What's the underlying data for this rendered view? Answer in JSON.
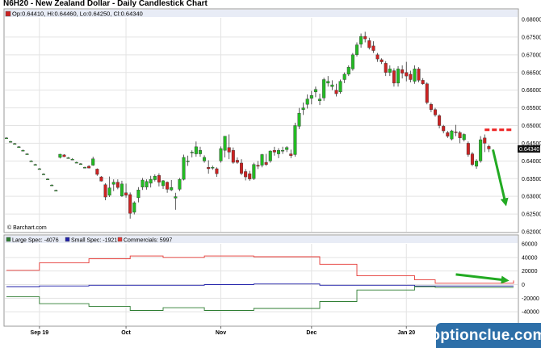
{
  "header": {
    "title": "N6H20 - New Zealand Dollar - Daily Candlestick Chart"
  },
  "watermark": {
    "text": "optionclue.com"
  },
  "colors": {
    "up": "#22bb22",
    "down": "#cc2222",
    "large_spec": "#2e7d32",
    "small_spec": "#2222aa",
    "commercials": "#e53935",
    "annotation": "#22aa22",
    "dash": "#ee2222"
  },
  "chart_data": [
    {
      "type": "candlestick",
      "title": "N6H20 - New Zealand Dollar - Daily Candlestick Chart",
      "info_line": "Op:0.64410, Hi:0.64460, Lo:0.64250, Cl:0.64340",
      "source_label": "© Barchart.com",
      "last_price_label": "0.64340",
      "ylim": [
        0.62,
        0.68
      ],
      "y_ticks": [
        "0.68000",
        "0.67500",
        "0.67000",
        "0.66500",
        "0.66000",
        "0.65500",
        "0.65000",
        "0.64500",
        "0.64000",
        "0.63500",
        "0.63000",
        "0.62500",
        "0.62000"
      ],
      "x_ticks": [
        "Sep 19",
        "Oct",
        "Nov",
        "Dec",
        "Jan 20"
      ],
      "x_tick_positions": [
        8,
        29,
        52,
        74,
        97
      ],
      "x_count": 124,
      "candles": [
        [
          0,
          0.6465,
          0.6467,
          0.6463,
          0.6465
        ],
        [
          1,
          0.6455,
          0.6457,
          0.6452,
          0.6455
        ],
        [
          2,
          0.6449,
          0.6451,
          0.6447,
          0.6449
        ],
        [
          3,
          0.644,
          0.6442,
          0.6438,
          0.644
        ],
        [
          4,
          0.643,
          0.6432,
          0.6428,
          0.643
        ],
        [
          5,
          0.642,
          0.6422,
          0.6418,
          0.642
        ],
        [
          6,
          0.64,
          0.6402,
          0.6398,
          0.64
        ],
        [
          7,
          0.639,
          0.6392,
          0.6388,
          0.639
        ],
        [
          8,
          0.6378,
          0.638,
          0.6376,
          0.6378
        ],
        [
          9,
          0.6363,
          0.6365,
          0.6361,
          0.6363
        ],
        [
          10,
          0.6349,
          0.6351,
          0.6347,
          0.6349
        ],
        [
          11,
          0.6332,
          0.6334,
          0.633,
          0.6332
        ],
        [
          12,
          0.6317,
          0.6319,
          0.6315,
          0.6317
        ],
        [
          13,
          0.641,
          0.642,
          0.6407,
          0.6419
        ],
        [
          14,
          0.6417,
          0.6419,
          0.6411,
          0.6412
        ],
        [
          15,
          0.6409,
          0.6411,
          0.6407,
          0.6409
        ],
        [
          16,
          0.6405,
          0.6408,
          0.6403,
          0.6405
        ],
        [
          17,
          0.6396,
          0.6398,
          0.6394,
          0.6396
        ],
        [
          18,
          0.6392,
          0.6394,
          0.639,
          0.6392
        ],
        [
          19,
          0.6382,
          0.6384,
          0.638,
          0.6382
        ],
        [
          20,
          0.6385,
          0.6388,
          0.6379,
          0.638
        ],
        [
          21,
          0.6388,
          0.6412,
          0.6386,
          0.6406
        ],
        [
          22,
          0.6377,
          0.6379,
          0.6358,
          0.6362
        ],
        [
          23,
          0.6355,
          0.6357,
          0.6342,
          0.6343
        ],
        [
          24,
          0.6333,
          0.6337,
          0.6289,
          0.6298
        ],
        [
          25,
          0.6303,
          0.6356,
          0.6298,
          0.6324
        ],
        [
          26,
          0.6334,
          0.6348,
          0.6315,
          0.634
        ],
        [
          27,
          0.634,
          0.6348,
          0.632,
          0.6325
        ],
        [
          28,
          0.6301,
          0.6344,
          0.6298,
          0.6335
        ],
        [
          29,
          0.631,
          0.6336,
          0.6296,
          0.6303
        ],
        [
          30,
          0.6305,
          0.6311,
          0.6237,
          0.6252
        ],
        [
          31,
          0.6255,
          0.6286,
          0.6249,
          0.6282
        ],
        [
          32,
          0.6296,
          0.6326,
          0.6283,
          0.6318
        ],
        [
          33,
          0.6326,
          0.6352,
          0.6318,
          0.6346
        ],
        [
          34,
          0.6326,
          0.6348,
          0.6319,
          0.6342
        ],
        [
          35,
          0.6337,
          0.6358,
          0.6325,
          0.6348
        ],
        [
          36,
          0.6347,
          0.6362,
          0.6342,
          0.6357
        ],
        [
          37,
          0.6359,
          0.6365,
          0.6328,
          0.634
        ],
        [
          38,
          0.633,
          0.6346,
          0.6321,
          0.6344
        ],
        [
          39,
          0.634,
          0.6342,
          0.631,
          0.632
        ],
        [
          40,
          0.6318,
          0.6346,
          0.6315,
          0.6325
        ],
        [
          41,
          0.6295,
          0.631,
          0.6262,
          0.6299
        ],
        [
          42,
          0.632,
          0.6352,
          0.6315,
          0.6348
        ],
        [
          43,
          0.6348,
          0.6418,
          0.6345,
          0.641
        ],
        [
          44,
          0.6398,
          0.6415,
          0.6386,
          0.64
        ],
        [
          45,
          0.6425,
          0.643,
          0.641,
          0.6425
        ],
        [
          46,
          0.642,
          0.6455,
          0.6412,
          0.644
        ],
        [
          47,
          0.642,
          0.644,
          0.6412,
          0.643
        ],
        [
          48,
          0.64,
          0.6416,
          0.6395,
          0.641
        ],
        [
          49,
          0.6382,
          0.6402,
          0.6364,
          0.6378
        ],
        [
          50,
          0.638,
          0.6387,
          0.6375,
          0.6382
        ],
        [
          51,
          0.6378,
          0.6382,
          0.6355,
          0.6364
        ],
        [
          52,
          0.64,
          0.6441,
          0.6395,
          0.6435
        ],
        [
          53,
          0.643,
          0.647,
          0.641,
          0.647
        ],
        [
          54,
          0.6438,
          0.6475,
          0.6405,
          0.6425
        ],
        [
          55,
          0.643,
          0.6438,
          0.6392,
          0.6396
        ],
        [
          56,
          0.6402,
          0.641,
          0.6392,
          0.6396
        ],
        [
          57,
          0.6394,
          0.6405,
          0.636,
          0.6365
        ],
        [
          58,
          0.637,
          0.6377,
          0.6345,
          0.6355
        ],
        [
          59,
          0.6364,
          0.6372,
          0.6344,
          0.6349
        ],
        [
          60,
          0.635,
          0.6395,
          0.6346,
          0.639
        ],
        [
          61,
          0.6388,
          0.64,
          0.6377,
          0.6385
        ],
        [
          62,
          0.6388,
          0.642,
          0.6382,
          0.6418
        ],
        [
          63,
          0.6396,
          0.642,
          0.6386,
          0.639
        ],
        [
          64,
          0.64,
          0.643,
          0.6395,
          0.6428
        ],
        [
          65,
          0.643,
          0.644,
          0.6415,
          0.6425
        ],
        [
          66,
          0.642,
          0.6436,
          0.6408,
          0.643
        ],
        [
          67,
          0.643,
          0.644,
          0.642,
          0.643
        ],
        [
          68,
          0.6432,
          0.6442,
          0.6425,
          0.6438
        ],
        [
          69,
          0.642,
          0.6432,
          0.6408,
          0.6415
        ],
        [
          70,
          0.6418,
          0.6508,
          0.6412,
          0.65
        ],
        [
          71,
          0.6498,
          0.655,
          0.649,
          0.6535
        ],
        [
          72,
          0.6545,
          0.6565,
          0.653,
          0.655
        ],
        [
          73,
          0.656,
          0.6588,
          0.6548,
          0.6575
        ],
        [
          74,
          0.6577,
          0.6598,
          0.656,
          0.6585
        ],
        [
          75,
          0.6595,
          0.661,
          0.658,
          0.6602
        ],
        [
          76,
          0.657,
          0.659,
          0.6558,
          0.6575
        ],
        [
          77,
          0.6578,
          0.6635,
          0.657,
          0.663
        ],
        [
          78,
          0.662,
          0.664,
          0.661,
          0.6625
        ],
        [
          79,
          0.661,
          0.6628,
          0.66,
          0.6615
        ],
        [
          80,
          0.66,
          0.6618,
          0.6582,
          0.659
        ],
        [
          81,
          0.6595,
          0.663,
          0.659,
          0.6625
        ],
        [
          82,
          0.663,
          0.665,
          0.662,
          0.6645
        ],
        [
          83,
          0.6645,
          0.667,
          0.664,
          0.6665
        ],
        [
          84,
          0.666,
          0.6705,
          0.6655,
          0.67
        ],
        [
          85,
          0.67,
          0.6735,
          0.6695,
          0.6728
        ],
        [
          86,
          0.673,
          0.676,
          0.672,
          0.6752
        ],
        [
          87,
          0.6752,
          0.6765,
          0.6735,
          0.6745
        ],
        [
          88,
          0.674,
          0.6748,
          0.6715,
          0.672
        ],
        [
          89,
          0.6725,
          0.6738,
          0.6705,
          0.6712
        ],
        [
          90,
          0.67,
          0.6705,
          0.668,
          0.6688
        ],
        [
          91,
          0.6686,
          0.669,
          0.6674,
          0.668
        ],
        [
          92,
          0.6676,
          0.6682,
          0.664,
          0.665
        ],
        [
          93,
          0.665,
          0.667,
          0.664,
          0.666
        ],
        [
          94,
          0.6655,
          0.6662,
          0.661,
          0.662
        ],
        [
          95,
          0.662,
          0.6668,
          0.661,
          0.666
        ],
        [
          96,
          0.6658,
          0.667,
          0.6633,
          0.6648
        ],
        [
          97,
          0.665,
          0.668,
          0.6625,
          0.664
        ],
        [
          98,
          0.6645,
          0.6655,
          0.6622,
          0.663
        ],
        [
          99,
          0.6625,
          0.667,
          0.6618,
          0.666
        ],
        [
          100,
          0.666,
          0.6665,
          0.6622,
          0.6628
        ],
        [
          101,
          0.6628,
          0.6634,
          0.6615,
          0.6618
        ],
        [
          102,
          0.6618,
          0.6622,
          0.656,
          0.6565
        ],
        [
          103,
          0.656,
          0.6565,
          0.6538,
          0.6545
        ],
        [
          104,
          0.6545,
          0.655,
          0.6525,
          0.653
        ],
        [
          105,
          0.6528,
          0.6532,
          0.6492,
          0.65
        ],
        [
          106,
          0.6498,
          0.6502,
          0.6478,
          0.6485
        ],
        [
          107,
          0.648,
          0.6485,
          0.6465,
          0.647
        ],
        [
          108,
          0.6462,
          0.6488,
          0.6458,
          0.6485
        ],
        [
          109,
          0.6482,
          0.6502,
          0.647,
          0.648
        ],
        [
          110,
          0.648,
          0.6485,
          0.645,
          0.6465
        ],
        [
          111,
          0.646,
          0.6478,
          0.6455,
          0.6475
        ],
        [
          112,
          0.645,
          0.6455,
          0.6412,
          0.6418
        ],
        [
          113,
          0.642,
          0.6425,
          0.6385,
          0.639
        ],
        [
          114,
          0.6385,
          0.6405,
          0.6378,
          0.64
        ],
        [
          115,
          0.64,
          0.647,
          0.6395,
          0.646
        ],
        [
          116,
          0.6465,
          0.6475,
          0.6425,
          0.645
        ],
        [
          117,
          0.6441,
          0.6446,
          0.6425,
          0.6434
        ]
      ],
      "dashed_level": {
        "value": 0.6488,
        "from_x": 116,
        "to_x": 123
      }
    },
    {
      "type": "line",
      "title": "",
      "legend": [
        {
          "label": "Large Spec: -4076"
        },
        {
          "label": "Small Spec: -1921"
        },
        {
          "label": "Commercials: 5997"
        }
      ],
      "ylim": [
        -60000,
        60000
      ],
      "y_ticks": [
        "60000",
        "40000",
        "20000",
        "0",
        "-20000",
        "-40000"
      ],
      "y_tick_values": [
        60000,
        40000,
        20000,
        0,
        -20000,
        -40000
      ],
      "series": [
        {
          "name": "Commercials",
          "points": [
            [
              0,
              21000
            ],
            [
              8,
              21000
            ],
            [
              8,
              32000
            ],
            [
              20,
              32000
            ],
            [
              20,
              38000
            ],
            [
              30,
              38000
            ],
            [
              30,
              42000
            ],
            [
              38,
              42000
            ],
            [
              38,
              40000
            ],
            [
              48,
              40000
            ],
            [
              48,
              42000
            ],
            [
              60,
              42000
            ],
            [
              60,
              41000
            ],
            [
              76,
              41000
            ],
            [
              76,
              30000
            ],
            [
              85,
              30000
            ],
            [
              85,
              13000
            ],
            [
              99,
              13000
            ],
            [
              99,
              7000
            ],
            [
              104,
              7000
            ],
            [
              104,
              2000
            ],
            [
              123,
              2000
            ],
            [
              123,
              6000
            ]
          ]
        },
        {
          "name": "Small Spec",
          "points": [
            [
              0,
              -3000
            ],
            [
              8,
              -3000
            ],
            [
              8,
              -2000
            ],
            [
              20,
              -2000
            ],
            [
              20,
              -1000
            ],
            [
              30,
              -1000
            ],
            [
              30,
              -1000
            ],
            [
              48,
              -1000
            ],
            [
              48,
              0
            ],
            [
              60,
              0
            ],
            [
              60,
              1000
            ],
            [
              76,
              1000
            ],
            [
              76,
              -1000
            ],
            [
              99,
              -1000
            ],
            [
              99,
              -2000
            ],
            [
              123,
              -2000
            ]
          ]
        },
        {
          "name": "Large Spec",
          "points": [
            [
              0,
              -18000
            ],
            [
              8,
              -18000
            ],
            [
              8,
              -28000
            ],
            [
              20,
              -28000
            ],
            [
              20,
              -32000
            ],
            [
              30,
              -32000
            ],
            [
              30,
              -38000
            ],
            [
              38,
              -38000
            ],
            [
              38,
              -34000
            ],
            [
              48,
              -34000
            ],
            [
              48,
              -38000
            ],
            [
              60,
              -38000
            ],
            [
              60,
              -35000
            ],
            [
              76,
              -35000
            ],
            [
              76,
              -25000
            ],
            [
              85,
              -25000
            ],
            [
              85,
              -8000
            ],
            [
              99,
              -8000
            ],
            [
              99,
              -3000
            ],
            [
              104,
              -3000
            ],
            [
              104,
              -4000
            ],
            [
              123,
              -4000
            ]
          ]
        }
      ]
    }
  ]
}
